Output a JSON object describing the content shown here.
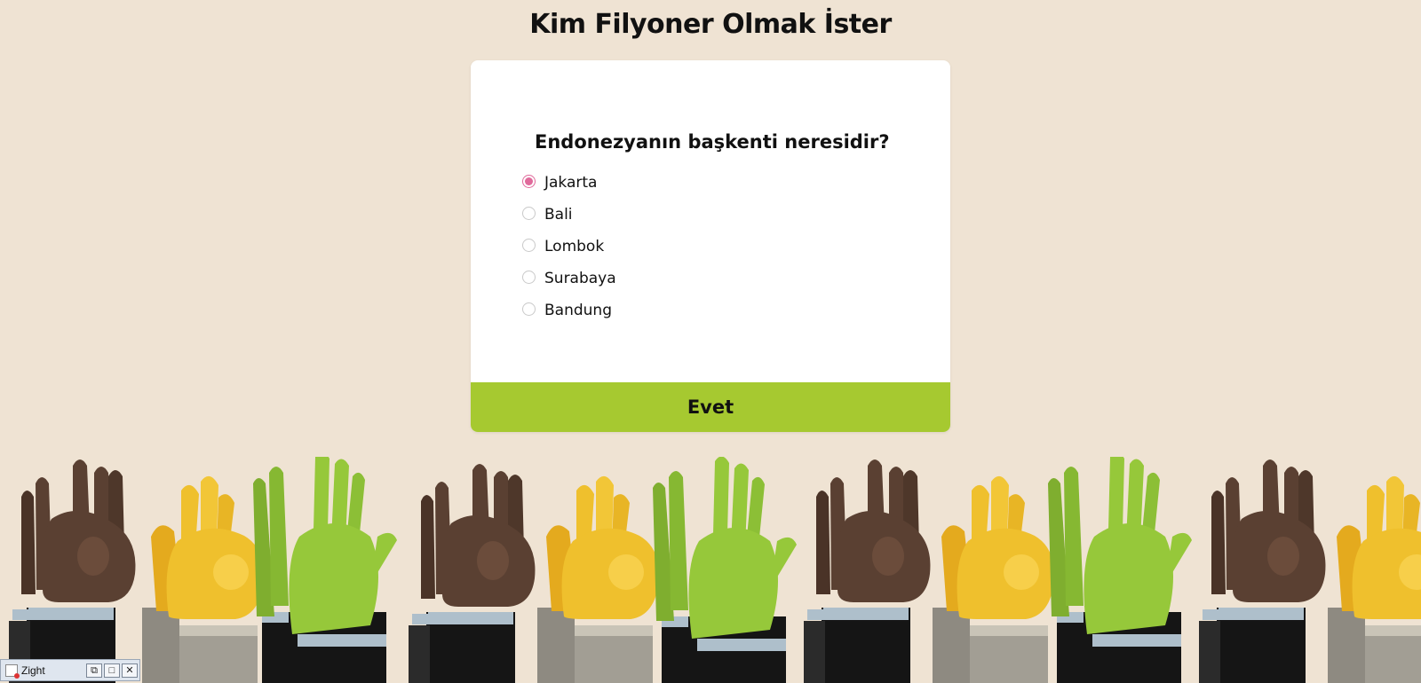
{
  "page": {
    "title": "Kim Filyoner Olmak İster"
  },
  "quiz": {
    "question": "Endonezyanın başkenti neresidir?",
    "options": [
      {
        "label": "Jakarta",
        "selected": true
      },
      {
        "label": "Bali",
        "selected": false
      },
      {
        "label": "Lombok",
        "selected": false
      },
      {
        "label": "Surabaya",
        "selected": false
      },
      {
        "label": "Bandung",
        "selected": false
      }
    ],
    "submit_label": "Evet"
  },
  "colors": {
    "background": "#efe3d3",
    "card": "#ffffff",
    "submit": "#a6c930",
    "radio_accent": "#e06a9b"
  },
  "decoration": {
    "icons": [
      "rock-hand-icon",
      "crossed-fingers-icon",
      "clapping-hands-icon"
    ],
    "hand_colors": [
      "#5a4032",
      "#efc02d",
      "#96c83a"
    ]
  },
  "taskbar": {
    "app_label": "Zight",
    "icons": [
      "zight-app-icon",
      "restore-icon",
      "maximize-icon",
      "close-icon"
    ]
  }
}
